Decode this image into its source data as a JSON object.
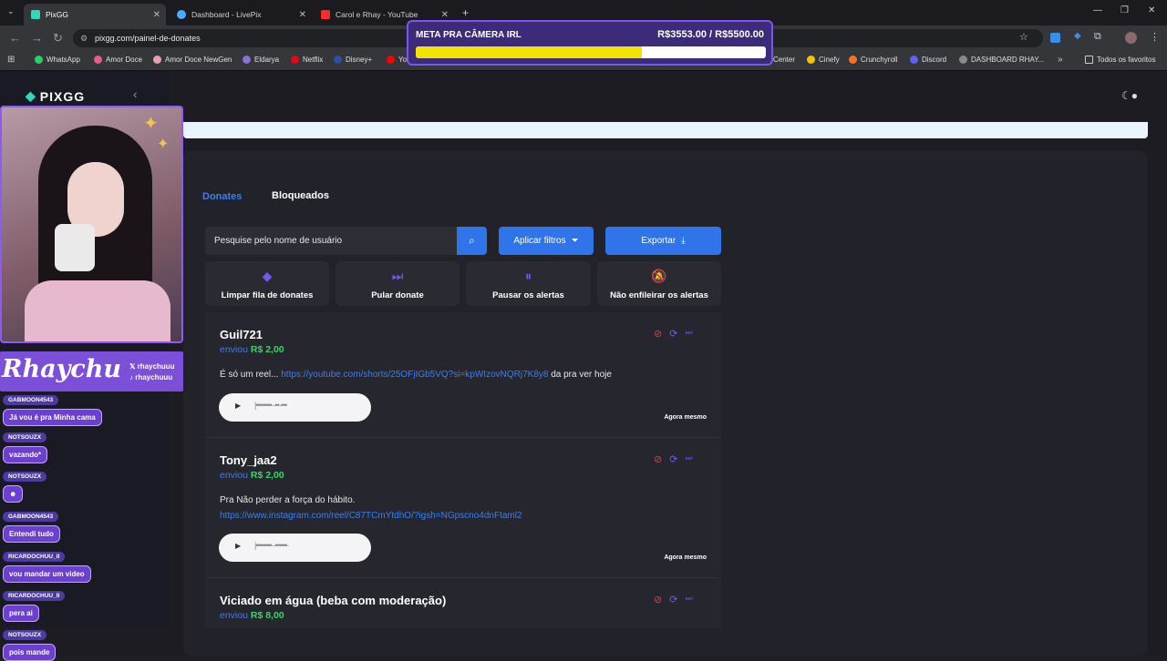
{
  "browser": {
    "tabs": [
      {
        "title": "PixGG",
        "color": "#32d6b8"
      },
      {
        "title": "Dashboard - LivePix",
        "color": "#4da6ff"
      },
      {
        "title": "Carol e Rhay - YouTube",
        "color": "#ff2a2a"
      }
    ],
    "url": "pixgg.com/painel-de-donates",
    "bookmarks": [
      "WhatsApp",
      "Amor Doce",
      "Amor Doce NewGen",
      "Eldarya",
      "Netflix",
      "Disney+",
      "Yo",
      "Center",
      "Cinefy",
      "Crunchyroll",
      "Discord",
      "DASHBOARD RHAY...",
      "Todos os favoritos"
    ]
  },
  "goal": {
    "label": "META PRA CÂMERA IRL",
    "value_text": "R$3553.00 / R$5500.00",
    "progress": 0.646
  },
  "app": {
    "logo": "PIXGG",
    "tabs": {
      "donates": "Donates",
      "blocked": "Bloqueados"
    },
    "search_placeholder": "Pesquise pelo nome de usuário",
    "filters_label": "Aplicar filtros",
    "export_label": "Exportar",
    "actions": [
      "Limpar fila de donates",
      "Pular donate",
      "Pausar os alertas",
      "Não enfileirar os alertas"
    ],
    "donates": [
      {
        "user": "Guil721",
        "sent_prefix": "enviou",
        "amount": "R$ 2,00",
        "text_before": "É só um reel... ",
        "link": "https://youtube.com/shorts/25OFjIGb5VQ?si=kpWIzovNQRj7K8y8",
        "text_after": " da pra ver hoje",
        "time": "Agora mesmo"
      },
      {
        "user": "Tony_jaa2",
        "sent_prefix": "enviou",
        "amount": "R$ 2,00",
        "text_before": "Pra Não perder a força do hábito.",
        "link": "https://www.instagram.com/reel/C87TCmYtdhO/?igsh=NGpscno4dnFtaml2",
        "time": "Agora mesmo"
      },
      {
        "user": "Viciado em água (beba com moderação)",
        "sent_prefix": "enviou",
        "amount": "R$ 8,00"
      }
    ]
  },
  "overlay": {
    "streamer_name": "Rhaychu",
    "handle_x": "rhaychuuu",
    "handle_tiktok": "rhaychuuu",
    "chat": [
      {
        "user": "GABMOON4543",
        "msg": "Já vou é pra Minha cama"
      },
      {
        "user": "NOTSOUZX",
        "msg": "vazando*"
      },
      {
        "user": "NOTSOUZX",
        "msg": "☻"
      },
      {
        "user": "GABMOON4543",
        "msg": "Entendi tudo"
      },
      {
        "user": "RICARDOCHUU_II",
        "msg": "vou mandar um video"
      },
      {
        "user": "RICARDOCHUU_II",
        "msg": "pera ai"
      },
      {
        "user": "NOTSOUZX",
        "msg": "pois mande"
      }
    ]
  }
}
